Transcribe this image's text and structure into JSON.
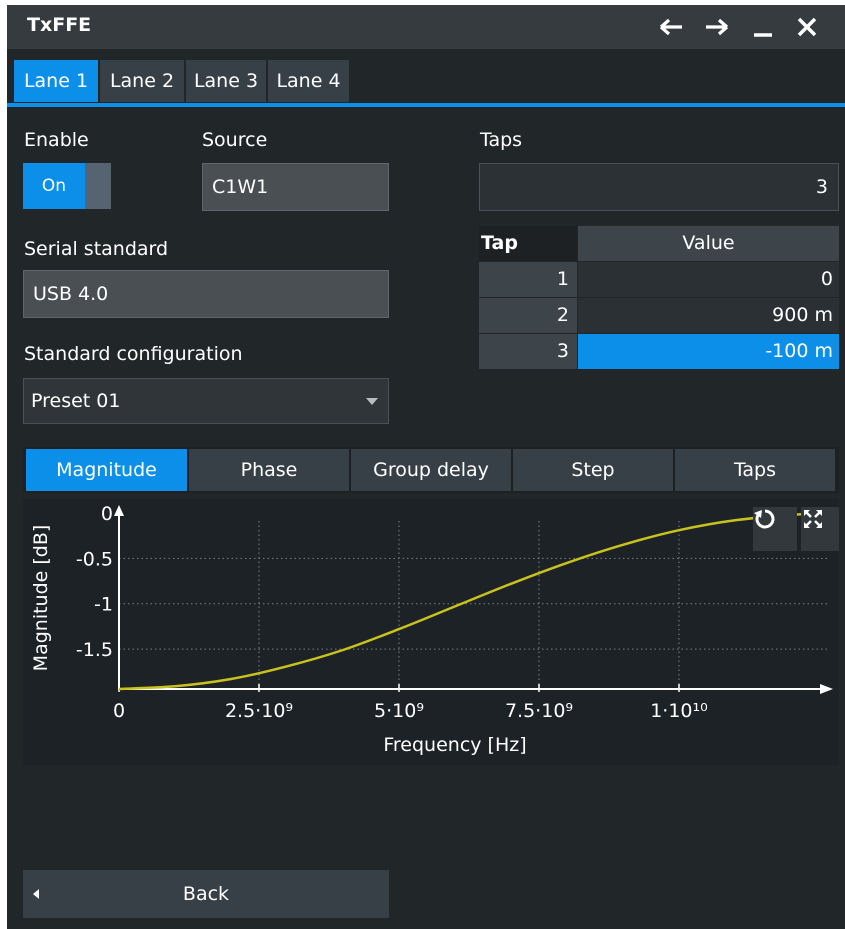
{
  "window": {
    "title": "TxFFE"
  },
  "lanes": [
    "Lane 1",
    "Lane 2",
    "Lane 3",
    "Lane 4"
  ],
  "enable": {
    "label": "Enable",
    "value": "On"
  },
  "source": {
    "label": "Source",
    "value": "C1W1"
  },
  "serial_standard": {
    "label": "Serial standard",
    "value": "USB 4.0"
  },
  "standard_configuration": {
    "label": "Standard configuration",
    "value": "Preset 01"
  },
  "taps": {
    "label": "Taps",
    "value": "3",
    "headers": [
      "Tap",
      "Value"
    ],
    "rows": [
      {
        "tap": "1",
        "value": "0"
      },
      {
        "tap": "2",
        "value": "900 m"
      },
      {
        "tap": "3",
        "value": "-100 m"
      }
    ]
  },
  "plot_tabs": [
    "Magnitude",
    "Phase",
    "Group delay",
    "Step",
    "Taps"
  ],
  "back": {
    "label": "Back"
  },
  "colors": {
    "accent": "#0b8fe8",
    "curve": "#c8c21e"
  },
  "chart_data": {
    "type": "line",
    "xlabel": "Frequency [Hz]",
    "ylabel": "Magnitude [dB]",
    "x_ticks": [
      "0",
      "2.5·10⁹",
      "5·10⁹",
      "7.5·10⁹",
      "1·10¹⁰"
    ],
    "y_ticks": [
      "0",
      "-0.5",
      "-1",
      "-1.5"
    ],
    "x_tick_values": [
      0,
      2500000000,
      5000000000,
      7500000000,
      10000000000
    ],
    "y_tick_values": [
      0,
      -0.5,
      -1,
      -1.5
    ],
    "xlim": [
      0,
      12500000000
    ],
    "ylim": [
      -1.94,
      0
    ],
    "grid": true,
    "series": [
      {
        "x": [
          0,
          1000000000,
          2000000000,
          3000000000,
          4000000000,
          5000000000,
          6000000000,
          7000000000,
          8000000000,
          9000000000,
          10000000000,
          11000000000,
          12000000000,
          12500000000
        ],
        "y": [
          -1.94,
          -1.91,
          -1.83,
          -1.69,
          -1.51,
          -1.28,
          -1.03,
          -0.78,
          -0.55,
          -0.35,
          -0.19,
          -0.08,
          -0.02,
          -0.01
        ]
      }
    ]
  }
}
